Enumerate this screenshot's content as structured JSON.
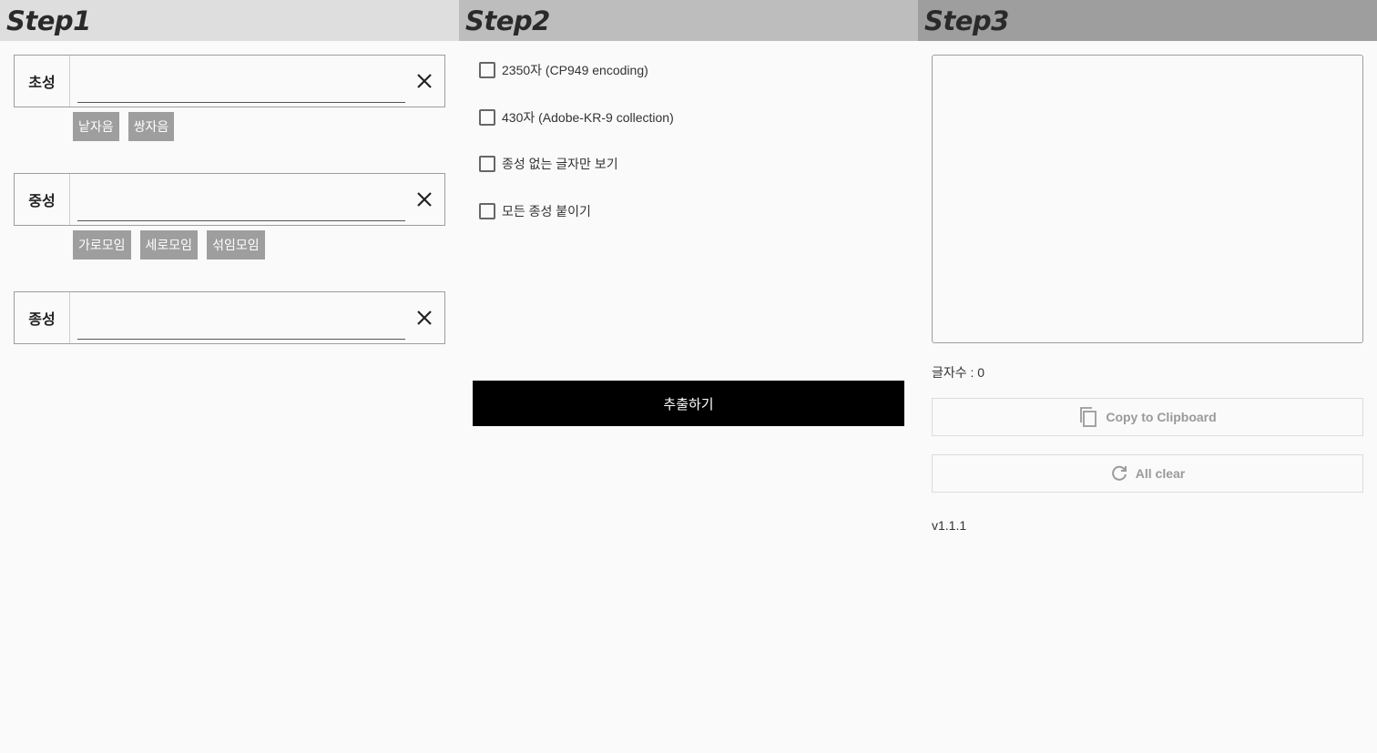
{
  "steps": {
    "step1": "Step1",
    "step2": "Step2",
    "step3": "Step3"
  },
  "step1": {
    "initial": {
      "label": "초성",
      "value": "",
      "chips": [
        "낱자음",
        "쌍자음"
      ]
    },
    "medial": {
      "label": "중성",
      "value": "",
      "chips": [
        "가로모임",
        "세로모임",
        "섞임모임"
      ]
    },
    "final": {
      "label": "종성",
      "value": ""
    }
  },
  "step2": {
    "options": [
      {
        "label": "2350자 (CP949 encoding)",
        "checked": false
      },
      {
        "label": "430자 (Adobe-KR-9 collection)",
        "checked": false
      },
      {
        "label": "종성 없는 글자만 보기",
        "checked": false
      },
      {
        "label": "모든 종성 붙이기",
        "checked": false
      }
    ],
    "extract_label": "추출하기"
  },
  "step3": {
    "result_text": "",
    "count_text": "글자수 : 0",
    "copy_label": "Copy to Clipboard",
    "clear_label": "All clear",
    "version": "v1.1.1"
  },
  "icons": {
    "clear": "close-icon",
    "copy": "copy-icon",
    "refresh": "refresh-icon"
  },
  "colors": {
    "step1_header": "#dedede",
    "step2_header": "#bdbdbd",
    "step3_header": "#9e9e9e",
    "chip_bg": "#9e9e9e",
    "primary_button": "#000000"
  }
}
